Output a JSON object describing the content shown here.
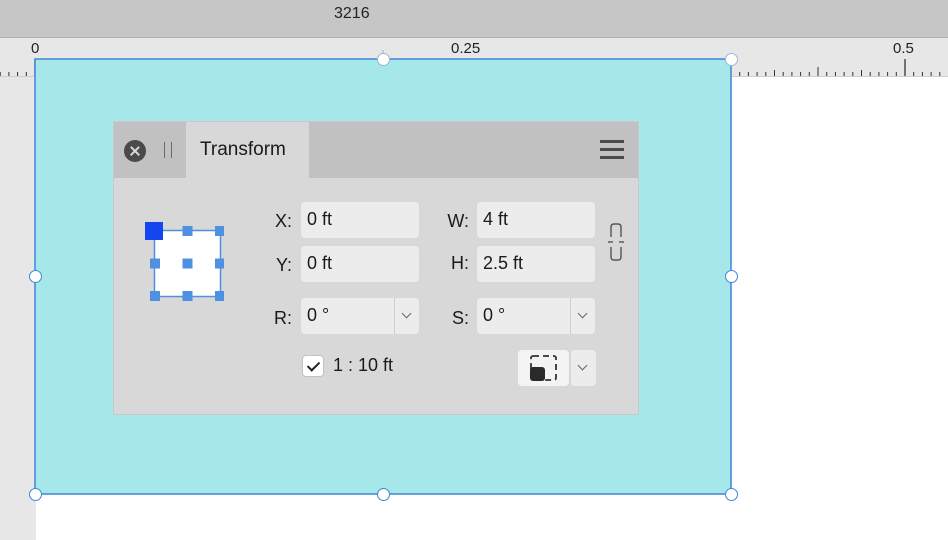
{
  "document": {
    "title": "3216"
  },
  "ruler": {
    "labels": [
      "0",
      "0.25",
      "0.5"
    ]
  },
  "panel": {
    "tab": "Transform",
    "x": {
      "label": "X:",
      "value": "0 ft"
    },
    "y": {
      "label": "Y:",
      "value": "0 ft"
    },
    "w": {
      "label": "W:",
      "value": "4 ft"
    },
    "h": {
      "label": "H:",
      "value": "2.5 ft"
    },
    "r": {
      "label": "R:",
      "value": "0 °"
    },
    "s": {
      "label": "S:",
      "value": "0 °"
    },
    "scale": {
      "checked": true,
      "label": "1 : 10 ft"
    }
  },
  "icons": [
    "close-icon",
    "grip-icon",
    "hamburger-menu-icon",
    "anchor-selector-icon",
    "link-proportions-icon",
    "origin-transform-icon",
    "chevron-down-icon"
  ],
  "colors": {
    "shape_fill": "#a6e8ea",
    "selection": "#3f86d9",
    "anchor_active": "#1446f0",
    "panel_bg": "#d8d8d8"
  }
}
